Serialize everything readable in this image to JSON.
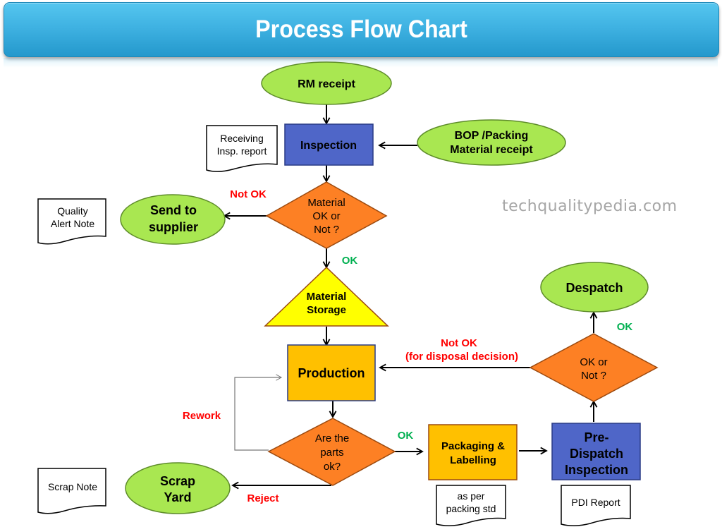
{
  "header": {
    "title": "Process Flow Chart"
  },
  "watermark": "techqualitypedia.com",
  "colors": {
    "banner": "#3fb2e2",
    "terminal_fill": "#a9e751",
    "terminal_stroke": "#5e8c2a",
    "process_blue": "#4f66c8",
    "process_orange": "#ffc000",
    "decision_fill": "#fd8024",
    "storage_fill": "#ffff00",
    "label_red": "#ff0000",
    "label_green": "#00b050"
  },
  "nodes": {
    "rm_receipt": {
      "type": "terminal",
      "lines": [
        "RM receipt"
      ]
    },
    "inspection": {
      "type": "process",
      "lines": [
        "Inspection"
      ]
    },
    "bop_receipt": {
      "type": "terminal",
      "lines": [
        "BOP /Packing",
        "Material receipt"
      ]
    },
    "receiving_report": {
      "type": "document",
      "lines": [
        "Receiving",
        "Insp. report"
      ]
    },
    "material_decision": {
      "type": "decision",
      "lines": [
        "Material",
        "OK or",
        "Not ?"
      ]
    },
    "send_to_supplier": {
      "type": "terminal",
      "lines": [
        "Send to",
        "supplier"
      ]
    },
    "quality_alert": {
      "type": "document",
      "lines": [
        "Quality",
        "Alert Note"
      ]
    },
    "material_storage": {
      "type": "storage",
      "lines": [
        "Material",
        "Storage"
      ]
    },
    "production": {
      "type": "process",
      "lines": [
        "Production"
      ]
    },
    "parts_decision": {
      "type": "decision",
      "lines": [
        "Are the",
        "parts",
        "ok?"
      ]
    },
    "scrap_yard": {
      "type": "terminal",
      "lines": [
        "Scrap",
        "Yard"
      ]
    },
    "scrap_note": {
      "type": "document",
      "lines": [
        "Scrap Note"
      ]
    },
    "packaging": {
      "type": "process",
      "lines": [
        "Packaging &",
        "Labelling"
      ]
    },
    "packing_std": {
      "type": "document",
      "lines": [
        "as per",
        "packing std"
      ]
    },
    "pdi": {
      "type": "process",
      "lines": [
        "Pre-",
        "Dispatch",
        "Inspection"
      ]
    },
    "pdi_report": {
      "type": "document",
      "lines": [
        "PDI Report"
      ]
    },
    "final_decision": {
      "type": "decision",
      "lines": [
        "OK or",
        "Not ?"
      ]
    },
    "despatch": {
      "type": "terminal",
      "lines": [
        "Despatch"
      ]
    }
  },
  "edge_labels": {
    "material_not_ok": "Not OK",
    "material_ok": "OK",
    "final_not_ok_1": "Not OK",
    "final_not_ok_2": "(for disposal decision)",
    "final_ok": "OK",
    "rework": "Rework",
    "parts_ok": "OK",
    "reject": "Reject"
  }
}
